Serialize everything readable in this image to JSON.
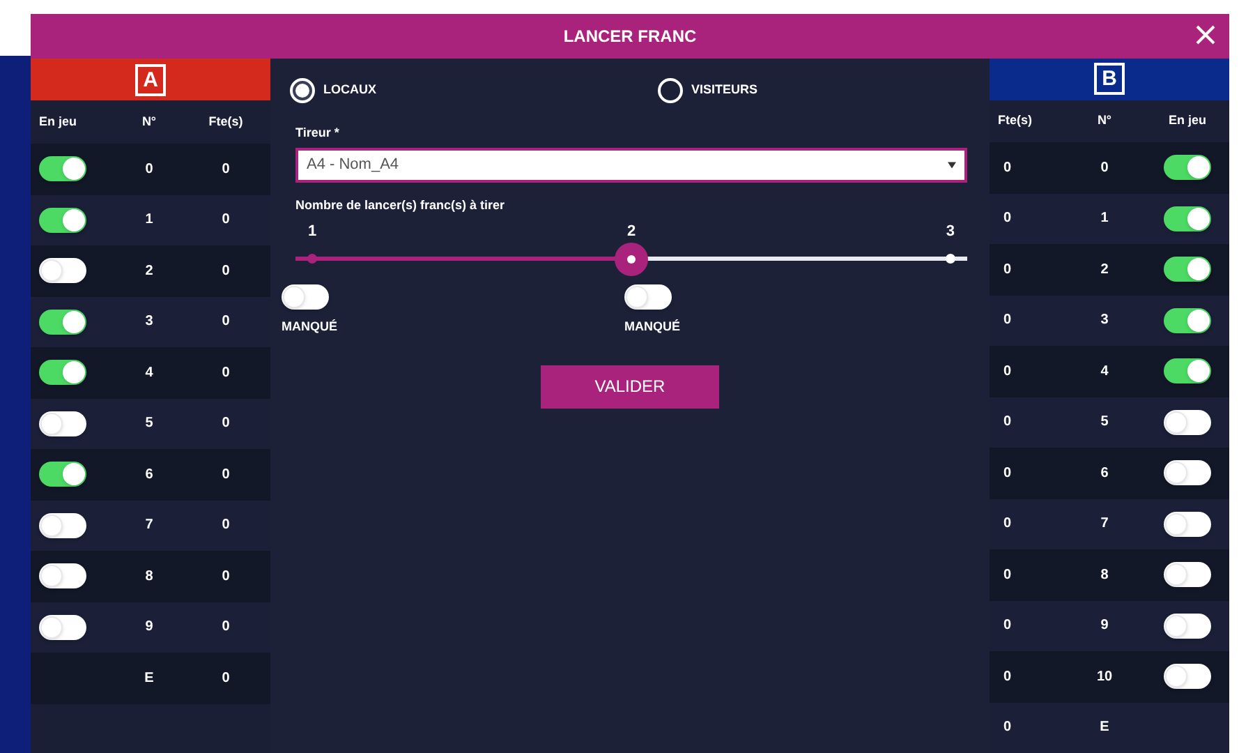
{
  "dialog": {
    "title": "LANCER FRANC"
  },
  "team_a": {
    "badge": "A",
    "columns": [
      "En jeu",
      "N°",
      "Fte(s)"
    ],
    "players": [
      {
        "number": "0",
        "fouls": "0",
        "on": true
      },
      {
        "number": "1",
        "fouls": "0",
        "on": true
      },
      {
        "number": "2",
        "fouls": "0",
        "on": false
      },
      {
        "number": "3",
        "fouls": "0",
        "on": true
      },
      {
        "number": "4",
        "fouls": "0",
        "on": true
      },
      {
        "number": "5",
        "fouls": "0",
        "on": false
      },
      {
        "number": "6",
        "fouls": "0",
        "on": true
      },
      {
        "number": "7",
        "fouls": "0",
        "on": false
      },
      {
        "number": "8",
        "fouls": "0",
        "on": false
      },
      {
        "number": "9",
        "fouls": "0",
        "on": false
      },
      {
        "number": "E",
        "fouls": "0"
      }
    ]
  },
  "team_choice": [
    {
      "label": "LOCAUX",
      "selected": true
    },
    {
      "label": "VISITEURS",
      "selected": false
    }
  ],
  "shooter": {
    "label": "Tireur *",
    "value": "A4 - Nom_A4"
  },
  "count": {
    "label": "Nombre de lancer(s) franc(s) à tirer",
    "ticks": [
      "1",
      "2",
      "3"
    ],
    "level": 0.5
  },
  "shots": [
    {
      "label": "MANQUÉ",
      "on": false
    },
    {
      "label": "MANQUÉ",
      "on": false
    }
  ],
  "submit": "VALIDER",
  "team_b": {
    "badge": "B",
    "columns": [
      "Fte(s)",
      "N°",
      "En jeu"
    ],
    "players": [
      {
        "number": "0",
        "fouls": "0",
        "on": true
      },
      {
        "number": "1",
        "fouls": "0",
        "on": true
      },
      {
        "number": "2",
        "fouls": "0",
        "on": true
      },
      {
        "number": "3",
        "fouls": "0",
        "on": true
      },
      {
        "number": "4",
        "fouls": "0",
        "on": true
      },
      {
        "number": "5",
        "fouls": "0",
        "on": false
      },
      {
        "number": "6",
        "fouls": "0",
        "on": false
      },
      {
        "number": "7",
        "fouls": "0",
        "on": false
      },
      {
        "number": "8",
        "fouls": "0",
        "on": false
      },
      {
        "number": "9",
        "fouls": "0",
        "on": false
      },
      {
        "number": "10",
        "fouls": "0",
        "on": false
      },
      {
        "number": "E",
        "fouls": "0"
      }
    ]
  }
}
